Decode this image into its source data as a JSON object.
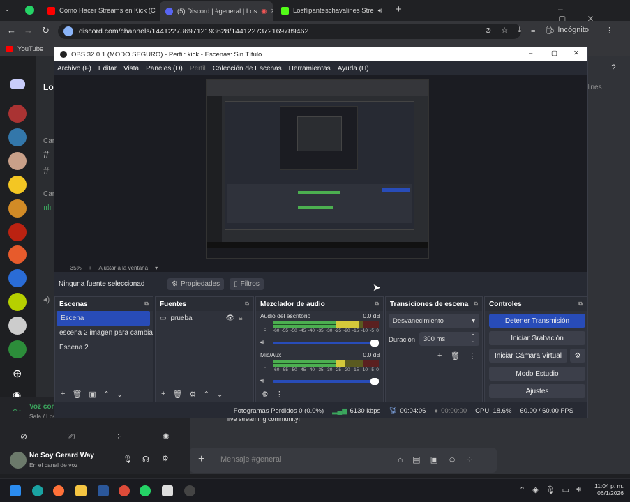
{
  "browser": {
    "tabs": [
      {
        "label": "Cómo Hacer Streams en Kick (C",
        "color": "#ff0000"
      },
      {
        "label": "(5) Discord | #general | Los",
        "color": "#5865f2"
      },
      {
        "label": "Losflipanteschavalines Stre",
        "color": "#53fc18"
      }
    ],
    "url": "discord.com/channels/1441227369712193628/1441227372169789462",
    "profile_label": "Incógnito",
    "bookmarks": [
      "YouTube"
    ]
  },
  "discord": {
    "channel_header_partial": "Los",
    "search_partial": "lines",
    "category_partial_1": "Car",
    "category_partial_2": "Car",
    "voice_status_title": "Voz con",
    "voice_status_sub": "Sala / Los",
    "user_name": "No Soy Gerard Way",
    "user_status": "En el canal de voz",
    "message_placeholder": "Mensaje #general",
    "message_snippet": "live streaming community!"
  },
  "obs": {
    "title": "OBS 32.0.1 (MODO SEGURO) - Perfil: kick - Escenas: Sin Título",
    "menu": [
      "Archivo (F)",
      "Editar",
      "Vista",
      "Paneles (D)",
      "Perfil",
      "Colección de Escenas",
      "Herramientas",
      "Ayuda (H)"
    ],
    "zoom": "35%",
    "fit_label": "Ajustar a la ventana",
    "no_source": "Ninguna fuente seleccionad",
    "properties_label": "Propiedades",
    "filters_label": "Filtros",
    "scenes": {
      "title": "Escenas",
      "items": [
        "Escena",
        "escena 2 imagen para cambiar",
        "Escena 2"
      ]
    },
    "sources": {
      "title": "Fuentes",
      "items": [
        "prueba"
      ]
    },
    "mixer": {
      "title": "Mezclador de audio",
      "channels": [
        {
          "name": "Audio del escritorio",
          "db": "0.0 dB",
          "level": 0.82
        },
        {
          "name": "Mic/Aux",
          "db": "0.0 dB",
          "level": 0.68
        }
      ],
      "scale": [
        "-60",
        "-55",
        "-50",
        "-45",
        "-40",
        "-35",
        "-30",
        "-25",
        "-20",
        "-15",
        "-10",
        "-5",
        "0"
      ]
    },
    "transitions": {
      "title": "Transiciones de escena",
      "selected": "Desvanecimiento",
      "duration_label": "Duración",
      "duration_value": "300 ms"
    },
    "controls": {
      "title": "Controles",
      "stop_stream": "Detener Transmisión",
      "start_rec": "Iniciar Grabación",
      "virtual_cam": "Iniciar Cámara Virtual",
      "studio": "Modo Estudio",
      "settings": "Ajustes"
    },
    "status": {
      "dropped": "Fotogramas Perdidos 0 (0.0%)",
      "bitrate": "6130 kbps",
      "stream_time": "00:04:06",
      "rec_time": "00:00:00",
      "cpu": "CPU: 18.6%",
      "fps": "60.00 / 60.00 FPS"
    }
  },
  "taskbar": {
    "time": "11:04 p. m.",
    "date": "06/1/2026"
  }
}
